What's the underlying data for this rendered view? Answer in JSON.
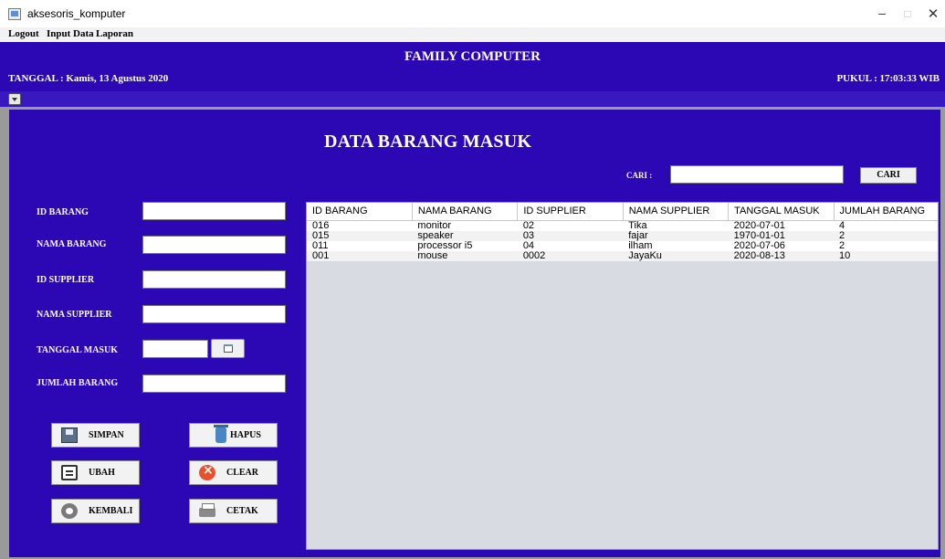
{
  "window": {
    "title": "aksesoris_komputer",
    "minimize_glyph": "–",
    "maximize_glyph": "□",
    "close_glyph": "✕"
  },
  "menu": [
    "Logout",
    "Input",
    "Data",
    "Laporan"
  ],
  "header": {
    "title": "FAMILY COMPUTER",
    "tanggal": "TANGGAL : Kamis, 13 Agustus 2020",
    "pukul": "PUKUL : 17:03:33 WIB"
  },
  "page_title": "DATA BARANG MASUK",
  "search": {
    "label": "CARI :",
    "value": "",
    "button": "CARI"
  },
  "form": {
    "fields": [
      {
        "label": "ID BARANG",
        "value": ""
      },
      {
        "label": "NAMA BARANG",
        "value": ""
      },
      {
        "label": "ID SUPPLIER",
        "value": ""
      },
      {
        "label": "NAMA SUPPLIER",
        "value": ""
      },
      {
        "label": "TANGGAL MASUK",
        "value": ""
      },
      {
        "label": "JUMLAH BARANG",
        "value": ""
      }
    ]
  },
  "buttons": {
    "simpan": "SIMPAN",
    "hapus": "HAPUS",
    "ubah": "UBAH",
    "clear": "CLEAR",
    "kembali": "KEMBALI",
    "cetak": "CETAK"
  },
  "table": {
    "columns": [
      "ID BARANG",
      "NAMA BARANG",
      "ID SUPPLIER",
      "NAMA SUPPLIER",
      "TANGGAL MASUK",
      "JUMLAH BARANG"
    ],
    "rows": [
      [
        "016",
        "monitor",
        "02",
        "Tika",
        "2020-07-01",
        "4"
      ],
      [
        "015",
        "speaker",
        "03",
        "fajar",
        "1970-01-01",
        "2"
      ],
      [
        "011",
        "processor i5",
        "04",
        "ilham",
        "2020-07-06",
        "2"
      ],
      [
        "001",
        "mouse",
        "0002",
        "JayaKu",
        "2020-08-13",
        "10"
      ]
    ]
  },
  "colors": {
    "panel_blue": "#2c08b5",
    "header_text": "#ffffff",
    "table_bg": "#d8dbe2"
  }
}
